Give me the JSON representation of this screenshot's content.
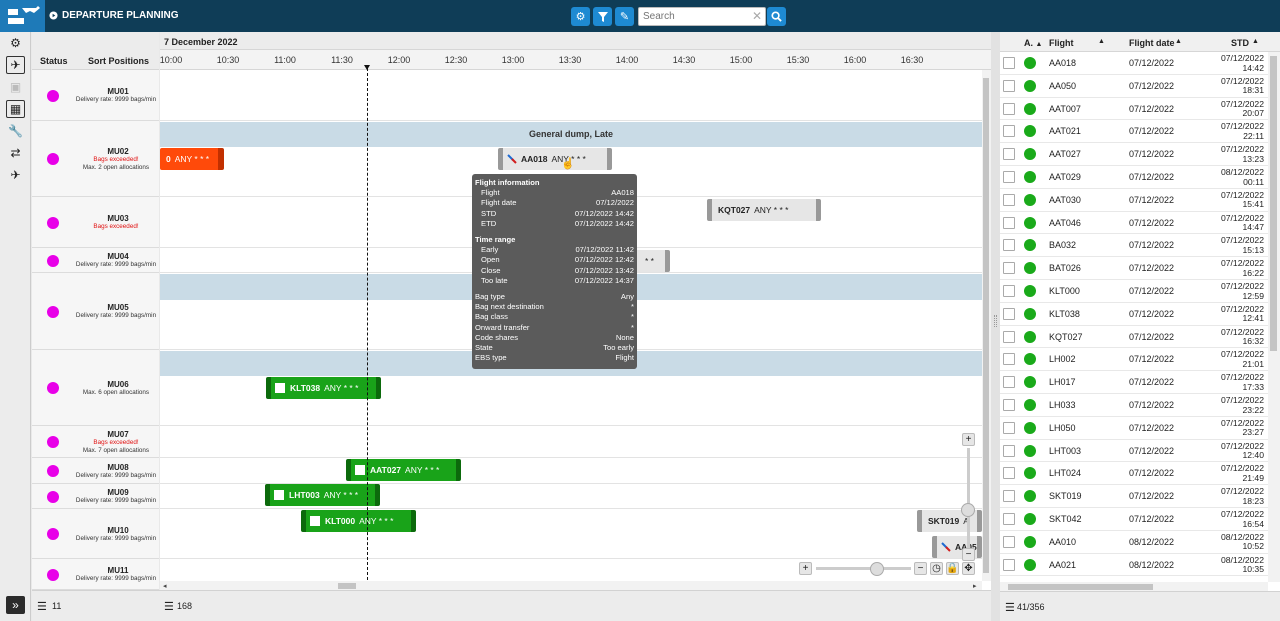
{
  "app": {
    "title": "DEPARTURE PLANNING"
  },
  "toolbar": {
    "settings_icon": "gear-icon",
    "filter_icon": "filter-icon",
    "edit_icon": "pencil-icon",
    "search_placeholder": "Search",
    "search_button_icon": "search-icon"
  },
  "left_toolbar": {
    "items": [
      "gear-icon",
      "takeoff-icon",
      "square-icon",
      "frame-icon",
      "wrench-icon",
      "transfer-icon",
      "plane-icon"
    ]
  },
  "sort_positions": {
    "status_header": "Status",
    "positions_header": "Sort Positions",
    "rows": [
      {
        "name": "MU01",
        "sub": [
          "Delivery rate: 9999 bags/min"
        ],
        "red": [
          false
        ]
      },
      {
        "name": "MU02",
        "sub": [
          "Bags exceeded!",
          "Max. 2 open allocations"
        ],
        "red": [
          true,
          false
        ]
      },
      {
        "name": "MU03",
        "sub": [
          "Bags exceeded!"
        ],
        "red": [
          true
        ]
      },
      {
        "name": "MU04",
        "sub": [
          "Delivery rate: 9999 bags/min"
        ],
        "red": [
          false
        ]
      },
      {
        "name": "MU05",
        "sub": [
          "Delivery rate: 9999 bags/min"
        ],
        "red": [
          false
        ]
      },
      {
        "name": "MU06",
        "sub": [
          "Max. 6 open allocations"
        ],
        "red": [
          false
        ]
      },
      {
        "name": "MU07",
        "sub": [
          "Bags exceeded!",
          "Max. 7 open allocations"
        ],
        "red": [
          true,
          false
        ]
      },
      {
        "name": "MU08",
        "sub": [
          "Delivery rate: 9999 bags/min"
        ],
        "red": [
          false
        ]
      },
      {
        "name": "MU09",
        "sub": [
          "Delivery rate: 9999 bags/min"
        ],
        "red": [
          false
        ]
      },
      {
        "name": "MU10",
        "sub": [
          "Delivery rate: 9999 bags/min"
        ],
        "red": [
          false
        ]
      },
      {
        "name": "MU11",
        "sub": [
          "Delivery rate: 9999 bags/min"
        ],
        "red": [
          false
        ]
      }
    ],
    "count": "11"
  },
  "timeline": {
    "date": "7 December 2022",
    "ticks": [
      "10:00",
      "10:30",
      "11:00",
      "11:30",
      "12:00",
      "12:30",
      "13:00",
      "13:30",
      "14:00",
      "14:30",
      "15:00",
      "15:30",
      "16:00",
      "16:30"
    ],
    "band_label": "General dump, Late",
    "count": "168",
    "bars": [
      {
        "flight": "0",
        "any": "ANY * * *",
        "color": "red"
      },
      {
        "flight": "AA018",
        "any": "ANY * * *",
        "color": "grey"
      },
      {
        "flight": "KQT027",
        "any": "ANY * * *",
        "color": "grey"
      },
      {
        "flight": "",
        "any": "* *",
        "color": "grey"
      },
      {
        "flight": "KLT038",
        "any": "ANY * * *",
        "color": "green"
      },
      {
        "flight": "AAT027",
        "any": "ANY * * *",
        "color": "green"
      },
      {
        "flight": "LHT003",
        "any": "ANY * * *",
        "color": "green"
      },
      {
        "flight": "KLT000",
        "any": "ANY * * *",
        "color": "green"
      },
      {
        "flight": "SKT019",
        "any": "A",
        "color": "grey"
      },
      {
        "flight": "AA05",
        "any": "",
        "color": "grey"
      }
    ]
  },
  "tooltip": {
    "section1": "Flight information",
    "flight_info": [
      [
        "Flight",
        "AA018"
      ],
      [
        "Flight date",
        "07/12/2022"
      ],
      [
        "STD",
        "07/12/2022 14:42"
      ],
      [
        "ETD",
        "07/12/2022 14:42"
      ]
    ],
    "section2": "Time range",
    "time_range": [
      [
        "Early",
        "07/12/2022 11:42"
      ],
      [
        "Open",
        "07/12/2022 12:42"
      ],
      [
        "Close",
        "07/12/2022 13:42"
      ],
      [
        "Too late",
        "07/12/2022 14:37"
      ]
    ],
    "details": [
      [
        "Bag type",
        "Any"
      ],
      [
        "Bag next destination",
        "*"
      ],
      [
        "Bag class",
        "*"
      ],
      [
        "Onward transfer",
        "*"
      ],
      [
        "Code shares",
        "None"
      ],
      [
        "State",
        "Too early"
      ],
      [
        "EBS type",
        "Flight"
      ]
    ]
  },
  "flights_grid": {
    "headers": {
      "a": "A.",
      "flight": "Flight",
      "date": "Flight date",
      "std": "STD"
    },
    "rows": [
      {
        "flight": "AA018",
        "date": "07/12/2022",
        "std1": "07/12/2022",
        "std2": "14:42"
      },
      {
        "flight": "AA050",
        "date": "07/12/2022",
        "std1": "07/12/2022",
        "std2": "18:31"
      },
      {
        "flight": "AAT007",
        "date": "07/12/2022",
        "std1": "07/12/2022",
        "std2": "20:07"
      },
      {
        "flight": "AAT021",
        "date": "07/12/2022",
        "std1": "07/12/2022",
        "std2": "22:11"
      },
      {
        "flight": "AAT027",
        "date": "07/12/2022",
        "std1": "07/12/2022",
        "std2": "13:23"
      },
      {
        "flight": "AAT029",
        "date": "07/12/2022",
        "std1": "08/12/2022",
        "std2": "00:11"
      },
      {
        "flight": "AAT030",
        "date": "07/12/2022",
        "std1": "07/12/2022",
        "std2": "15:41"
      },
      {
        "flight": "AAT046",
        "date": "07/12/2022",
        "std1": "07/12/2022",
        "std2": "14:47"
      },
      {
        "flight": "BA032",
        "date": "07/12/2022",
        "std1": "07/12/2022",
        "std2": "15:13"
      },
      {
        "flight": "BAT026",
        "date": "07/12/2022",
        "std1": "07/12/2022",
        "std2": "16:22"
      },
      {
        "flight": "KLT000",
        "date": "07/12/2022",
        "std1": "07/12/2022",
        "std2": "12:59"
      },
      {
        "flight": "KLT038",
        "date": "07/12/2022",
        "std1": "07/12/2022",
        "std2": "12:41"
      },
      {
        "flight": "KQT027",
        "date": "07/12/2022",
        "std1": "07/12/2022",
        "std2": "16:32"
      },
      {
        "flight": "LH002",
        "date": "07/12/2022",
        "std1": "07/12/2022",
        "std2": "21:01"
      },
      {
        "flight": "LH017",
        "date": "07/12/2022",
        "std1": "07/12/2022",
        "std2": "17:33"
      },
      {
        "flight": "LH033",
        "date": "07/12/2022",
        "std1": "07/12/2022",
        "std2": "23:22"
      },
      {
        "flight": "LH050",
        "date": "07/12/2022",
        "std1": "07/12/2022",
        "std2": "23:27"
      },
      {
        "flight": "LHT003",
        "date": "07/12/2022",
        "std1": "07/12/2022",
        "std2": "12:40"
      },
      {
        "flight": "LHT024",
        "date": "07/12/2022",
        "std1": "07/12/2022",
        "std2": "21:49"
      },
      {
        "flight": "SKT019",
        "date": "07/12/2022",
        "std1": "07/12/2022",
        "std2": "18:23"
      },
      {
        "flight": "SKT042",
        "date": "07/12/2022",
        "std1": "07/12/2022",
        "std2": "16:54"
      },
      {
        "flight": "AA010",
        "date": "08/12/2022",
        "std1": "08/12/2022",
        "std2": "10:52"
      },
      {
        "flight": "AA021",
        "date": "08/12/2022",
        "std1": "08/12/2022",
        "std2": "10:35"
      }
    ],
    "count": "41/356"
  },
  "colors": {
    "topbar": "#0f3d57",
    "accent": "#1e8ad2",
    "status_magenta": "#e800e8",
    "status_green": "#1aaa1a",
    "bar_green": "#19a319",
    "band": "#c9dbe6",
    "tooltip": "#5b5b5b"
  }
}
